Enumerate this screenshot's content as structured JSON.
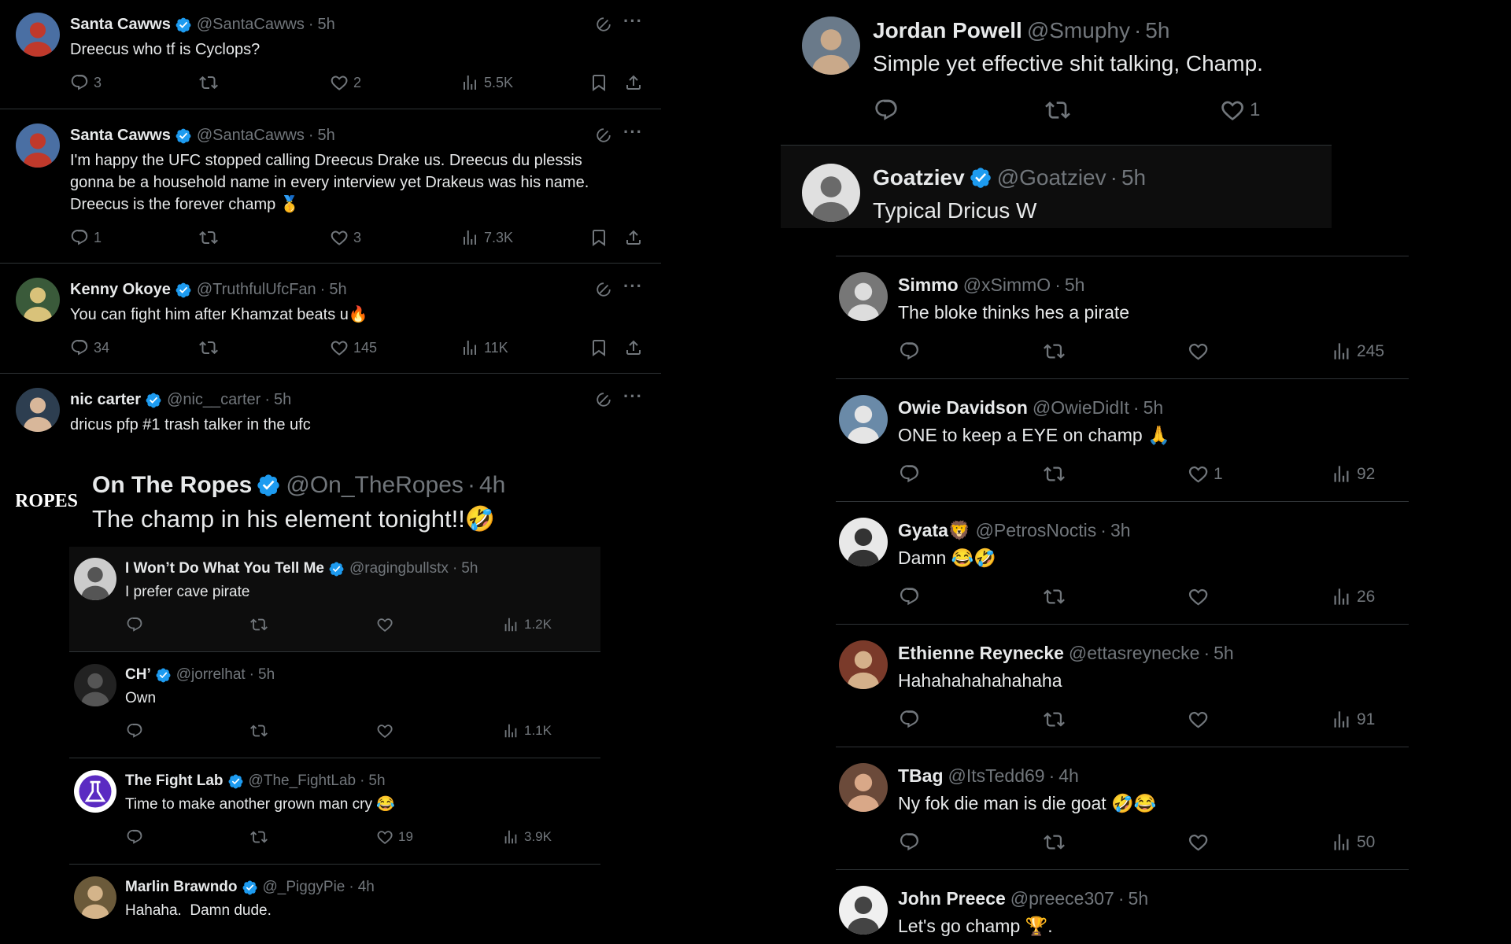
{
  "left_top": [
    {
      "name": "Santa Cawws",
      "handle": "@SantaCawws",
      "time": "5h",
      "verified": true,
      "text": "Dreecus who tf is Cyclops?",
      "replies": "3",
      "reposts": "",
      "likes": "2",
      "views": "5.5K"
    },
    {
      "name": "Santa Cawws",
      "handle": "@SantaCawws",
      "time": "5h",
      "verified": true,
      "text": "I'm happy the UFC stopped calling Dreecus Drake us. Dreecus du plessis\ngonna be a household name in every interview yet Drakeus was his name.\nDreecus is the forever champ 🥇",
      "replies": "1",
      "reposts": "",
      "likes": "3",
      "views": "7.3K"
    },
    {
      "name": "Kenny Okoye",
      "handle": "@TruthfulUfcFan",
      "time": "5h",
      "verified": true,
      "text": "You can fight him after Khamzat beats u🔥",
      "replies": "34",
      "reposts": "",
      "likes": "145",
      "views": "11K"
    },
    {
      "name": "nic carter",
      "handle": "@nic__carter",
      "time": "5h",
      "verified": true,
      "text": "dricus pfp #1 trash talker in the ufc",
      "replies": "",
      "reposts": "",
      "likes": "",
      "views": ""
    }
  ],
  "left_bottom": {
    "main": {
      "name": "On The Ropes",
      "handle": "@On_TheRopes",
      "time": "4h",
      "verified": true,
      "text": "The champ in his element tonight!!🤣",
      "avatar_text": "ROPES"
    },
    "replies": [
      {
        "name": "I Won’t Do What You Tell Me",
        "handle": "@ragingbullstx",
        "time": "5h",
        "verified": true,
        "text": "I prefer cave pirate",
        "replies": "",
        "reposts": "",
        "likes": "",
        "views": "1.2K"
      },
      {
        "name": "CH’",
        "handle": "@jorrelhat",
        "time": "5h",
        "verified": true,
        "text": "Own",
        "replies": "",
        "reposts": "",
        "likes": "",
        "views": "1.1K"
      },
      {
        "name": "The Fight Lab",
        "handle": "@The_FightLab",
        "time": "5h",
        "verified": true,
        "text": "Time to make another grown man cry 😂",
        "replies": "",
        "reposts": "",
        "likes": "19",
        "views": "3.9K"
      },
      {
        "name": "Marlin Brawndo",
        "handle": "@_PiggyPie",
        "time": "4h",
        "verified": true,
        "text": "Hahaha.  Damn dude.",
        "replies": "",
        "reposts": "",
        "likes": "",
        "views": ""
      }
    ]
  },
  "right_top": [
    {
      "name": "Jordan Powell",
      "handle": "@Smuphy",
      "time": "5h",
      "verified": false,
      "text": "Simple yet effective shit talking, Champ.",
      "replies": "",
      "reposts": "",
      "likes": "1"
    },
    {
      "name": "Goatziev",
      "handle": "@Goatziev",
      "time": "5h",
      "verified": true,
      "text": "Typical Dricus W"
    }
  ],
  "right_replies": [
    {
      "name": "Simmo",
      "handle": "@xSimmO",
      "time": "5h",
      "text": "The bloke thinks hes a pirate",
      "likes": "",
      "views": "245"
    },
    {
      "name": "Owie Davidson",
      "handle": "@OwieDidIt",
      "time": "5h",
      "text": "ONE to keep a EYE on champ 🙏",
      "likes": "1",
      "views": "92"
    },
    {
      "name": "Gyata🦁",
      "handle": "@PetrosNoctis",
      "time": "3h",
      "text": "Damn 😂🤣",
      "likes": "",
      "views": "26"
    },
    {
      "name": "Ethienne Reynecke",
      "handle": "@ettasreynecke",
      "time": "5h",
      "text": "Hahahahahahahaha",
      "likes": "",
      "views": "91"
    },
    {
      "name": "TBag",
      "handle": "@ItsTedd69",
      "time": "4h",
      "text": "Ny fok die man is die goat 🤣😂",
      "likes": "",
      "views": "50"
    },
    {
      "name": "John Preece",
      "handle": "@preece307",
      "time": "5h",
      "text": "Let's go champ 🏆.",
      "likes": "",
      "views": ""
    }
  ],
  "colors": {
    "bg": "#000000",
    "text": "#e7e9ea",
    "muted": "#71767b",
    "divider": "#2f3336",
    "verified": "#1d9bf0",
    "highlight": "#0d0d0d"
  }
}
